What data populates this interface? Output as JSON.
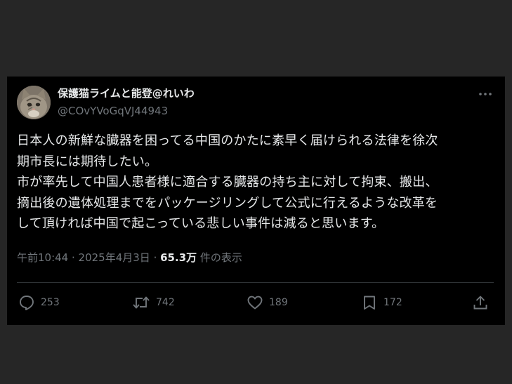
{
  "post": {
    "author": {
      "display_name": "保護猫ライムと能登@れいわ",
      "handle": "@COvYVoGqVJ44943",
      "avatar_icon": "cat-photo-avatar"
    },
    "more_icon": "more-dots-icon",
    "text": "日本人の新鮮な臓器を困ってる中国のかたに素早く届けられる法律を徐次\n期市長には期待したい。\n市が率先して中国人患者様に適合する臓器の持ち主に対して拘束、搬出、\n摘出後の遺体処理までをパッケージリングして公式に行えるような改革を\nして頂ければ中国で起こっている悲しい事件は減ると思います。",
    "meta": {
      "time": "午前10:44",
      "separator1": " · ",
      "date": "2025年4月3日",
      "separator2": " · ",
      "views": "65.3万",
      "views_label": " 件の表示"
    },
    "actions": {
      "reply": {
        "icon": "reply-icon",
        "count": "253"
      },
      "repost": {
        "icon": "repost-icon",
        "count": "742"
      },
      "like": {
        "icon": "heart-icon",
        "count": "189"
      },
      "bookmark": {
        "icon": "bookmark-icon",
        "count": "172"
      },
      "share": {
        "icon": "share-icon"
      }
    }
  },
  "colors": {
    "page_background": "#262626",
    "card_background": "#000000",
    "primary_text": "#e7e9ea",
    "secondary_text": "#71767b",
    "divider": "#2f3336"
  }
}
